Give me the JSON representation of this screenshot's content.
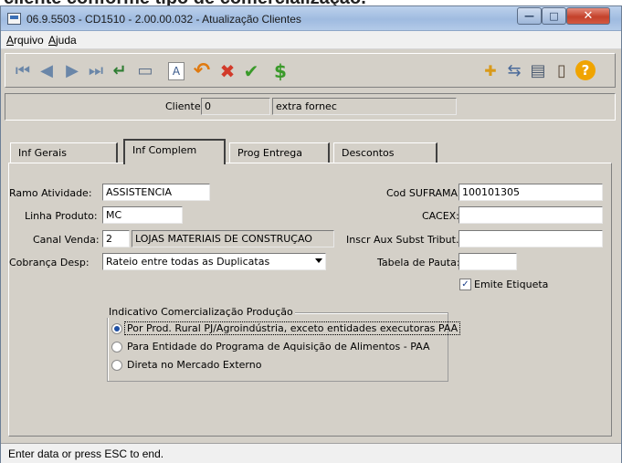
{
  "top_text": "cliente conforme tipo de comercialização.",
  "window": {
    "title": "06.9.5503 - CD1510 - 2.00.00.032 - Atualização Clientes",
    "buttons": {
      "minimize": "—",
      "maximize": "□",
      "close": "✕"
    }
  },
  "menu": {
    "items": [
      "Arquivo",
      "Ajuda"
    ]
  },
  "toolbar": {
    "left_icons": [
      "first-icon",
      "previous-icon",
      "next-icon",
      "last-icon",
      "return-icon",
      "zoom-icon",
      "form-icon",
      "undo-icon",
      "delete-icon",
      "confirm-icon",
      "currency-icon"
    ],
    "right_icons": [
      "folder-open-icon",
      "network-icon",
      "print-icon",
      "exit-icon",
      "help-icon"
    ],
    "glyphs": {
      "first": "⏮",
      "previous": "◀",
      "next": "▶",
      "last": "⏭",
      "return": "↵",
      "zoom": "▭",
      "form": "A",
      "undo": "↶",
      "delete": "✖",
      "confirm": "✔",
      "currency": "$",
      "folder": "✚",
      "network": "⇆",
      "print": "▤",
      "exit": "▯",
      "help": "?"
    }
  },
  "cliente": {
    "label": "Cliente:",
    "code": "0",
    "name": "extra fornec",
    "extra": ""
  },
  "tabs": [
    "Inf Gerais",
    "Inf Complem",
    "Prog Entrega",
    "Descontos"
  ],
  "active_tab": "Inf Complem",
  "form": {
    "ramo_atividade": {
      "label": "Ramo Atividade:",
      "value": "ASSISTENCIA"
    },
    "linha_produto": {
      "label": "Linha Produto:",
      "value": "MC"
    },
    "canal_venda": {
      "label": "Canal Venda:",
      "code": "2",
      "description": "LOJAS MATERIAIS DE CONSTRUÇAO"
    },
    "cobranca_desp": {
      "label": "Cobrança Desp:",
      "selected": "Rateio entre todas as Duplicatas"
    },
    "cod_suframa": {
      "label": "Cod SUFRAMA:",
      "value": "100101305"
    },
    "cacex": {
      "label": "CACEX:",
      "value": ""
    },
    "inscr_aux": {
      "label": "Inscr Aux Subst Tribut.:",
      "value": ""
    },
    "tabela_pauta": {
      "label": "Tabela de Pauta:",
      "value": ""
    },
    "emite_etiqueta": {
      "label": "Emite Etiqueta",
      "checked": true,
      "check_glyph": "✓"
    }
  },
  "indicativo": {
    "title": "Indicativo Comercialização Produção",
    "options": [
      "Por Prod. Rural PJ/Agroindústria, exceto entidades executoras PAA",
      "Para Entidade do Programa de Aquisição de Alimentos - PAA",
      "Direta no Mercado Externo"
    ],
    "selected_index": 0
  },
  "status": {
    "text": "Enter data or press ESC to end."
  },
  "colors": {
    "window_bg": "#d4d0c8",
    "title_gradient_top": "#bcd1ec",
    "close_button": "#c4412b",
    "return_icon": "#2e7d32",
    "undo_icon": "#e07a10",
    "delete_icon": "#d23a2a",
    "confirm_icon": "#3a9a2a",
    "currency_icon": "#3a9a2a",
    "help_icon": "#f0a400",
    "nav_icon": "#6a86a8"
  }
}
